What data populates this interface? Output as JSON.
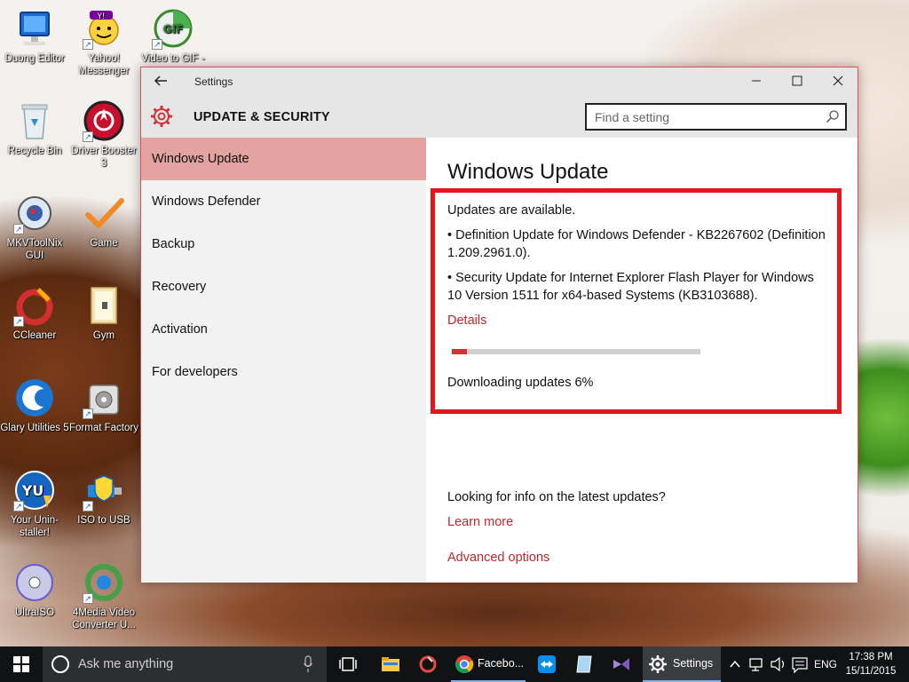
{
  "desktop_icons": [
    {
      "label": "Duong Editor",
      "icon": "monitor-icon"
    },
    {
      "label": "Yahoo! Messenger",
      "icon": "yahoo-messenger-icon"
    },
    {
      "label": "Video to GIF -",
      "icon": "gif-icon"
    },
    {
      "label": "Recycle Bin",
      "icon": "recycle-bin-icon"
    },
    {
      "label": "Driver Booster 3",
      "icon": "driver-booster-icon"
    },
    {
      "label": "MKVToolNix GUI",
      "icon": "mkvtoolnix-icon"
    },
    {
      "label": "Game",
      "icon": "checkmark-icon"
    },
    {
      "label": "CCleaner",
      "icon": "ccleaner-icon"
    },
    {
      "label": "Gym",
      "icon": "folder-icon"
    },
    {
      "label": "Glary Utilities 5",
      "icon": "glary-icon"
    },
    {
      "label": "Format Factory",
      "icon": "format-factory-icon"
    },
    {
      "label": "Your Unin-staller!",
      "icon": "uninstaller-icon"
    },
    {
      "label": "ISO to USB",
      "icon": "iso-to-usb-icon"
    },
    {
      "label": "UltraISO",
      "icon": "disc-icon"
    },
    {
      "label": "4Media Video Converter U...",
      "icon": "video-converter-icon"
    }
  ],
  "window": {
    "title": "Settings",
    "section_title": "UPDATE & SECURITY",
    "search_placeholder": "Find a setting",
    "nav_items": [
      {
        "label": "Windows Update",
        "active": true
      },
      {
        "label": "Windows Defender",
        "active": false
      },
      {
        "label": "Backup",
        "active": false
      },
      {
        "label": "Recovery",
        "active": false
      },
      {
        "label": "Activation",
        "active": false
      },
      {
        "label": "For developers",
        "active": false
      }
    ],
    "content": {
      "page_title": "Windows Update",
      "status": "Updates are available.",
      "updates": [
        "• Definition Update for Windows Defender - KB2267602 (Definition 1.209.2961.0).",
        "• Security Update for Internet Explorer Flash Player for Windows 10 Version 1511 for x64-based Systems (KB3103688)."
      ],
      "details_link": "Details",
      "progress_percent": 6,
      "progress_text": "Downloading updates 6%",
      "info_text": "Looking for info on the latest updates?",
      "learn_more_link": "Learn more",
      "advanced_options_link": "Advanced options"
    }
  },
  "taskbar": {
    "search_placeholder": "Ask me anything",
    "apps": [
      {
        "label": "",
        "icon": "task-view-icon"
      },
      {
        "label": "",
        "icon": "file-explorer-icon"
      },
      {
        "label": "",
        "icon": "ccleaner-taskbar-icon"
      },
      {
        "label": "Facebo...",
        "icon": "chrome-icon"
      },
      {
        "label": "",
        "icon": "teamviewer-icon"
      },
      {
        "label": "",
        "icon": "notepad-icon"
      },
      {
        "label": "",
        "icon": "visual-studio-icon"
      },
      {
        "label": "Settings",
        "icon": "settings-gear-icon"
      }
    ],
    "language": "ENG",
    "time": "17:38 PM",
    "date": "15/11/2015"
  },
  "colors": {
    "accent": "#d13438",
    "nav_active": "#e3a3a0",
    "highlight_border": "#e3161f",
    "taskbar": "#101214"
  }
}
